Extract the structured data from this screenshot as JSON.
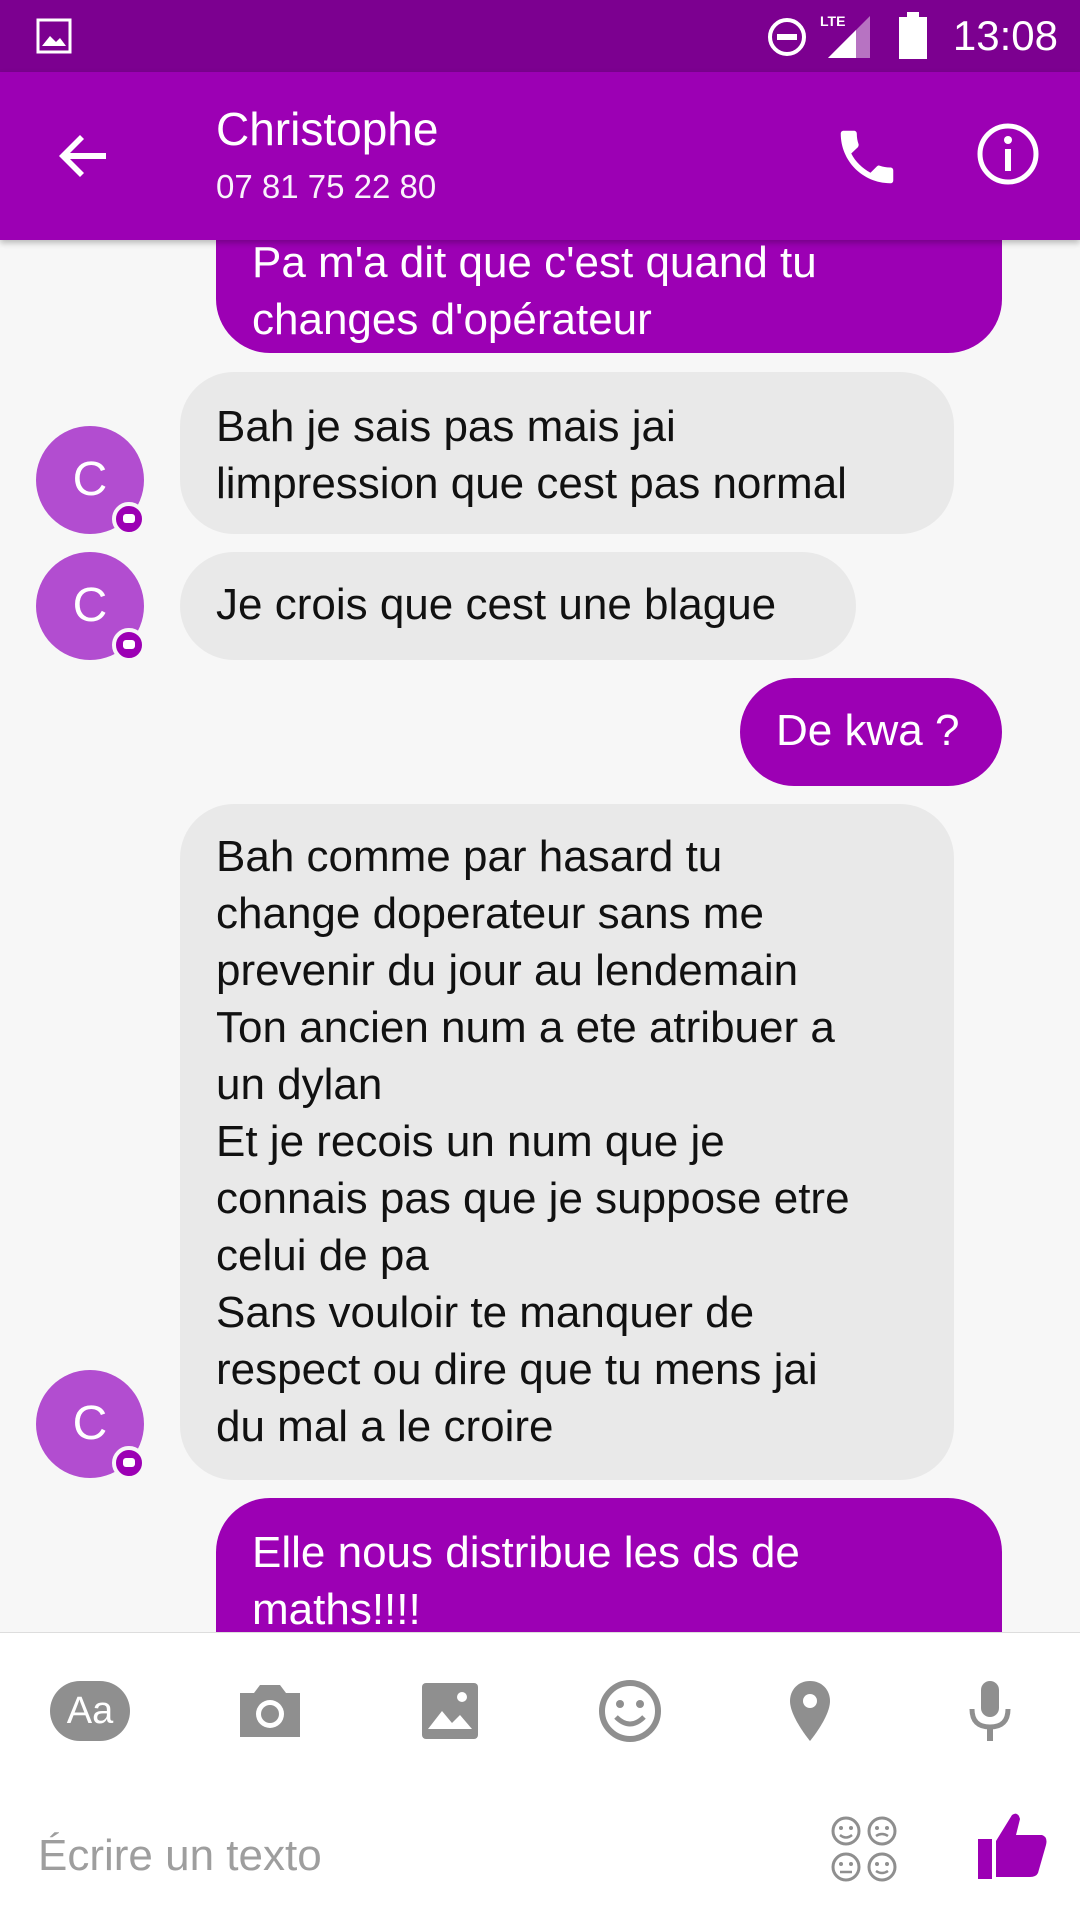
{
  "status_bar": {
    "time": "13:08",
    "network": "LTE"
  },
  "header": {
    "contact_name": "Christophe",
    "phone_number": "07 81 75 22 80"
  },
  "messages": [
    {
      "direction": "out",
      "text": "Pa m'a dit que c'est quand tu\nchanges d'opérateur"
    },
    {
      "direction": "in",
      "avatar_letter": "C",
      "text": "Bah je sais pas mais jai\nlimpression que cest pas normal"
    },
    {
      "direction": "in",
      "avatar_letter": "C",
      "text": "Je crois que cest une blague"
    },
    {
      "direction": "out",
      "text": "De kwa ?"
    },
    {
      "direction": "in",
      "avatar_letter": "C",
      "text": "Bah comme par hasard tu\nchange doperateur sans me\nprevenir du jour au lendemain\nTon ancien num a ete atribuer a\nun dylan\nEt je recois un num que je\nconnais pas que je suppose etre\ncelui de pa\nSans vouloir te manquer de\nrespect ou dire que tu mens jai\ndu mal a le croire"
    },
    {
      "direction": "out",
      "text": "Elle nous distribue les ds de\nmaths!!!!"
    }
  ],
  "composer": {
    "text_format_label": "Aa",
    "placeholder": "Écrire un texto"
  },
  "colors": {
    "primary": "#9c00b4",
    "status_bar": "#7c0090",
    "incoming_bubble": "#e9e9e9",
    "avatar": "#b24dd0"
  }
}
